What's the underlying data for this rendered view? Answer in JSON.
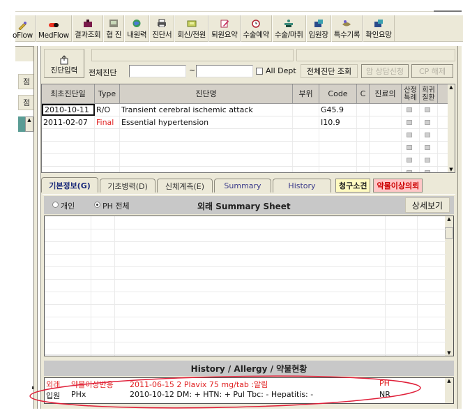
{
  "toolbar": {
    "items": [
      {
        "label": "oFlow",
        "icon": "pen-icon"
      },
      {
        "label": "MedFlow",
        "icon": "pill-icon"
      },
      {
        "label": "결과조회",
        "icon": "lab-result-icon"
      },
      {
        "label": "협 진",
        "icon": "consult-icon"
      },
      {
        "label": "내원력",
        "icon": "globe-icon"
      },
      {
        "label": "진단서",
        "icon": "printer-icon"
      },
      {
        "label": "회신/전원",
        "icon": "folder-icon"
      },
      {
        "label": "퇴원요약",
        "icon": "note-icon"
      },
      {
        "label": "수술예약",
        "icon": "clock-icon"
      },
      {
        "label": "수술/마취",
        "icon": "surgery-icon"
      },
      {
        "label": "입원장",
        "icon": "admission-icon"
      },
      {
        "label": "특수기록",
        "icon": "record-icon"
      },
      {
        "label": "확인요망",
        "icon": "check-icon"
      }
    ]
  },
  "sidebar": {
    "items": [
      {
        "label": "점"
      },
      {
        "label": "점"
      }
    ]
  },
  "filter": {
    "diag_input_label": "진단입력",
    "all_diag_label": "전체진단",
    "date_from": "",
    "date_to": "",
    "tilde": "~",
    "all_dept_label": "All Dept",
    "all_dept_checked": false,
    "lookup_button": "전체진단 조회",
    "cancer_button": "암 상담신청",
    "cp_button": "CP 해제"
  },
  "diagnosis_table": {
    "columns": [
      "최초진단일",
      "Type",
      "진단명",
      "부위",
      "Code",
      "C",
      "진료의",
      "산정\n특례",
      "희귀\n질환"
    ],
    "rows": [
      {
        "date": "2010-10-11",
        "type": "R/O",
        "name": "Transient cerebral ischemic attack",
        "site": "",
        "code": "G45.9",
        "c": "",
        "doctor": ""
      },
      {
        "date": "2011-02-07",
        "type": "Final",
        "name": "Essential hypertension",
        "site": "",
        "code": "I10.9",
        "c": "",
        "doctor": ""
      }
    ],
    "empty_rows": 4
  },
  "tabs": [
    {
      "label": "기본정보(G)",
      "active": true
    },
    {
      "label": "기초병력(D)",
      "active": false
    },
    {
      "label": "신체계측(E)",
      "active": false
    },
    {
      "label": "Summary",
      "active": false
    },
    {
      "label": "History",
      "active": false
    }
  ],
  "tags": {
    "claim": "청구소견",
    "adr": "약물이상의뢰"
  },
  "summary": {
    "radio_personal": "개인",
    "radio_ph_all": "PH 전체",
    "selected": "PH 전체",
    "title": "외래 Summary Sheet",
    "detail_button": "상세보기"
  },
  "history": {
    "title": "History / Allergy / 약물현황",
    "rows": [
      {
        "setting": "외래",
        "category": "약물이상반응",
        "detail": "2011-06-15 2 Plavix 75 mg/tab :알림",
        "source": "PH",
        "highlight": true
      },
      {
        "setting": "입원",
        "category": "PHx",
        "detail": "2010-10-12 DM: + HTN: + Pul Tbc: - Hepatitis: -",
        "source": "NR",
        "highlight": false
      }
    ]
  },
  "colors": {
    "window_bg": "#ece9d8",
    "header_gray": "#c8c8c8",
    "alert_red": "#e02020",
    "tag_yellow": "#fffac0",
    "tag_pink": "#ffc7c7",
    "annotation_red": "#e0203a"
  }
}
